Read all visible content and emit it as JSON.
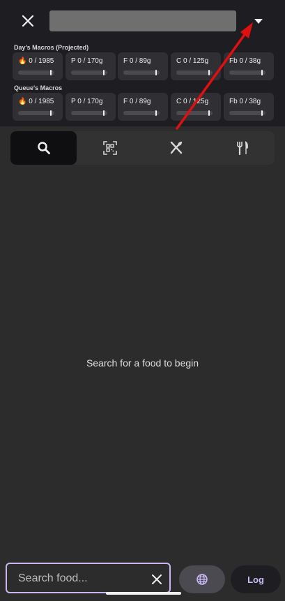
{
  "header": {
    "selector_value": ""
  },
  "sections": [
    {
      "label": "Day's Macros (Projected)",
      "macros": [
        {
          "text": "🔥 0 / 1985",
          "progress": 0
        },
        {
          "text": "P 0 / 170g",
          "progress": 0
        },
        {
          "text": "F 0 / 89g",
          "progress": 0
        },
        {
          "text": "C 0 / 125g",
          "progress": 0
        },
        {
          "text": "Fb 0 / 38g",
          "progress": 0
        }
      ]
    },
    {
      "label": "Queue's Macros",
      "macros": [
        {
          "text": "🔥 0 / 1985",
          "progress": 0
        },
        {
          "text": "P 0 / 170g",
          "progress": 0
        },
        {
          "text": "F 0 / 89g",
          "progress": 0
        },
        {
          "text": "C 0 / 125g",
          "progress": 0
        },
        {
          "text": "Fb 0 / 38g",
          "progress": 0
        }
      ]
    }
  ],
  "tabs": [
    {
      "icon": "search-icon",
      "active": true
    },
    {
      "icon": "barcode-scan-icon",
      "active": false
    },
    {
      "icon": "utensils-crossed-icon",
      "active": false
    },
    {
      "icon": "fork-knife-icon",
      "active": false
    }
  ],
  "main": {
    "empty_message": "Search for a food to begin"
  },
  "bottom": {
    "search_placeholder": "Search food...",
    "search_value": "",
    "log_label": "Log",
    "globe_icon": "globe-icon"
  },
  "colors": {
    "accent": "#cdbcf6",
    "header_bg": "#1e1e22",
    "body_bg": "#2c2c2c",
    "annotation_arrow": "#e01010"
  }
}
